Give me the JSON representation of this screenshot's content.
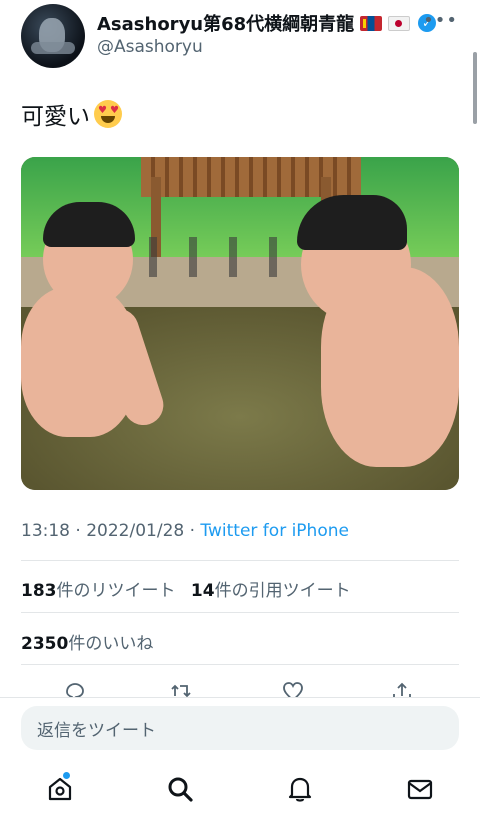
{
  "header": {
    "display_name": "Asashoryu第68代横綱朝青龍",
    "handle": "@Asashoryu",
    "more_label": "•••"
  },
  "tweet": {
    "text": "可愛い",
    "emoji_icon": "heart-eyes-emoji-icon"
  },
  "meta": {
    "time": "13:18",
    "sep1": " · ",
    "date": "2022/01/28",
    "sep2": " · ",
    "source": "Twitter for iPhone"
  },
  "stats": {
    "retweets_count": "183",
    "retweets_label": "件のリツイート",
    "quotes_count": "14",
    "quotes_label": "件の引用ツイート",
    "likes_count": "2350",
    "likes_label": "件のいいね"
  },
  "reply": {
    "placeholder": "返信をツイート"
  },
  "colors": {
    "accent": "#1d9bf0",
    "text_primary": "#0f1419",
    "text_secondary": "#536471"
  },
  "tab_bar": [
    "home-icon",
    "search-icon",
    "notifications-icon",
    "messages-icon"
  ]
}
